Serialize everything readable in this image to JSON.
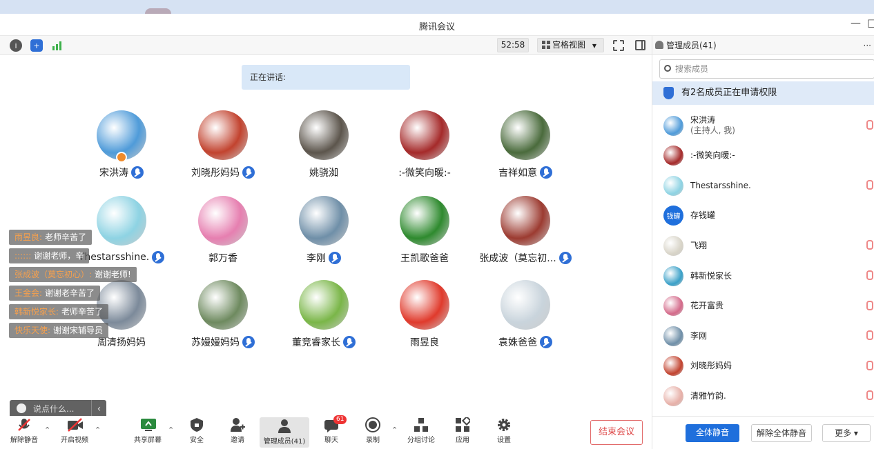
{
  "window": {
    "title": "腾讯会议",
    "minimize": "—",
    "maximize": "□"
  },
  "toolbar": {
    "timer": "52:58",
    "view_mode": "宫格视图",
    "view_caret": "▼"
  },
  "main": {
    "speaking_label": "正在讲话:"
  },
  "participants": [
    {
      "name": "宋洪涛",
      "mic": true,
      "host": true,
      "color": "#4f9bd9"
    },
    {
      "name": "刘晓彤妈妈",
      "mic": true,
      "color": "#c2432f"
    },
    {
      "name": "姚骁洳",
      "mic": false,
      "color": "#5c554c"
    },
    {
      "name": ":-微笑向暖:-",
      "mic": false,
      "color": "#a52a2a"
    },
    {
      "name": "吉祥如意",
      "mic": true,
      "color": "#4a6b3c"
    },
    {
      "name": "Thestarsshine.",
      "mic": true,
      "color": "#8ed3e3"
    },
    {
      "name": "郭万香",
      "mic": false,
      "color": "#e67fb0"
    },
    {
      "name": "李刚",
      "mic": true,
      "color": "#6f8fa8"
    },
    {
      "name": "王凯歌爸爸",
      "mic": false,
      "color": "#2e8a2e"
    },
    {
      "name": "张成波（莫忘初...",
      "mic": true,
      "color": "#9c3b31"
    },
    {
      "name": "周清扬妈妈",
      "mic": false,
      "color": "#7c8a9a"
    },
    {
      "name": "苏嫚嫚妈妈",
      "mic": true,
      "color": "#6e8a5f"
    },
    {
      "name": "董竞睿家长",
      "mic": true,
      "color": "#7ab648"
    },
    {
      "name": "雨昱良",
      "mic": false,
      "color": "#e03a2c"
    },
    {
      "name": "袁姝爸爸",
      "mic": true,
      "color": "#c9d4dc"
    }
  ],
  "chat": [
    {
      "who": "雨昱良:",
      "msg": "老师辛苦了"
    },
    {
      "who": "::::::",
      "msg": "谢谢老师，辛"
    },
    {
      "who": "张成波（莫忘初心）:",
      "msg": "谢谢老师!"
    },
    {
      "who": "王金会:",
      "msg": "谢谢老辛苦了"
    },
    {
      "who": "韩新悦家长:",
      "msg": "老师辛苦了"
    },
    {
      "who": "快乐天使:",
      "msg": "谢谢宋辅导员"
    }
  ],
  "chat_input": {
    "placeholder": "说点什么...",
    "collapse": "‹"
  },
  "bottom": {
    "unmute": "解除静音",
    "start_video": "开启视频",
    "share": "共享屏幕",
    "security": "安全",
    "invite": "邀请",
    "manage": "管理成员(41)",
    "chat": "聊天",
    "chat_badge": "61",
    "record": "录制",
    "breakout": "分组讨论",
    "apps": "应用",
    "settings": "设置",
    "end": "结束会议"
  },
  "panel": {
    "title": "管理成员(41)",
    "more": "···",
    "search_placeholder": "搜索成员",
    "notice": "有2名成员正在申请权限",
    "members": [
      {
        "name": "宋洪涛",
        "sub": "(主持人, 我)",
        "color": "#4f9bd9"
      },
      {
        "name": ":-微笑向暖:-",
        "color": "#a52a2a"
      },
      {
        "name": "Thestarsshine.",
        "color": "#8ed3e3"
      },
      {
        "name": "存钱罐",
        "color": "#1f6fdc",
        "initial": "钱罐"
      },
      {
        "name": "飞翔",
        "color": "#d8d4c8"
      },
      {
        "name": "韩新悦家长",
        "color": "#3aa0c8"
      },
      {
        "name": "花开富贵",
        "color": "#d46a8a"
      },
      {
        "name": "李刚",
        "color": "#6f8fa8"
      },
      {
        "name": "刘晓彤妈妈",
        "color": "#c2432f"
      },
      {
        "name": "清雅竹韵.",
        "color": "#e7b0a8"
      }
    ],
    "mute_all": "全体静音",
    "unmute_all": "解除全体静音",
    "more_btn": "更多 ▾"
  }
}
